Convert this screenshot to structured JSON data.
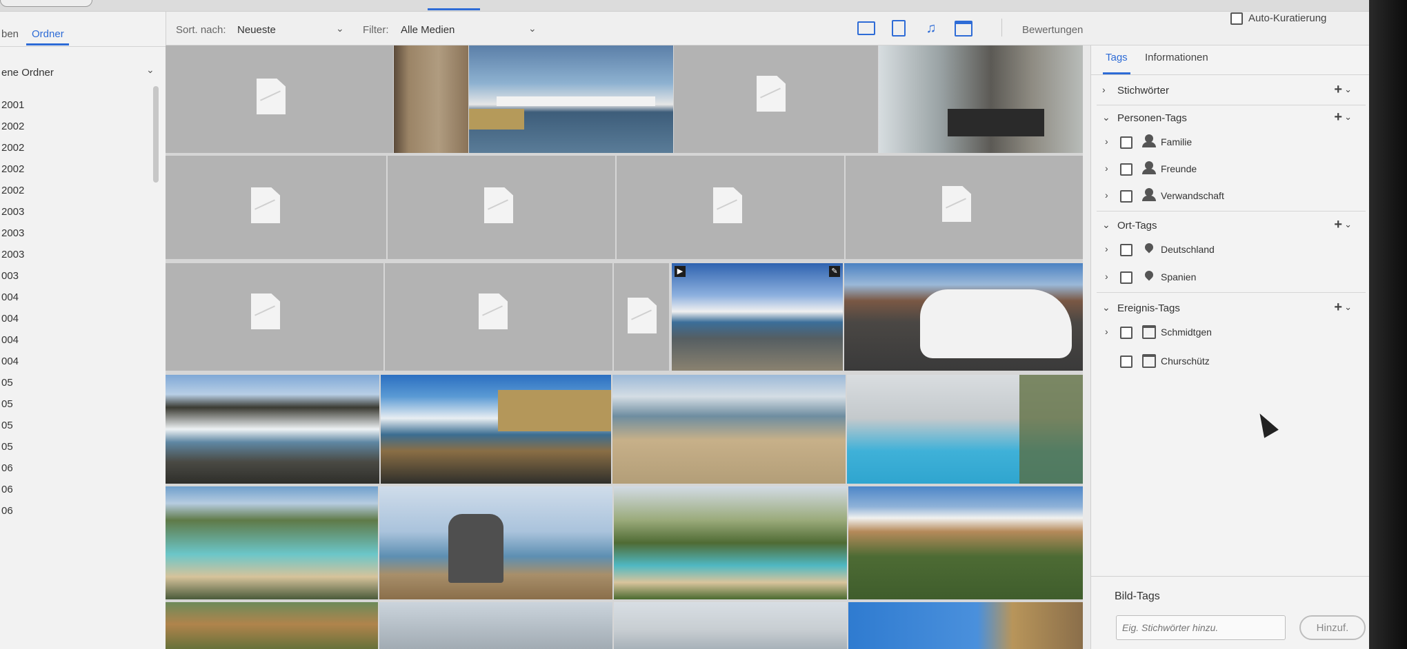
{
  "top": {
    "active_tab_indicator": true
  },
  "left_panel": {
    "tabs": [
      "ben",
      "Ordner"
    ],
    "active_tab": "Ordner",
    "tree_header": "ene Ordner",
    "years": [
      "2001",
      "2002",
      "2002",
      "2002",
      "2002",
      "2003",
      "2003",
      "2003",
      "003",
      "004",
      "004",
      "004",
      "004",
      "05",
      "05",
      "05",
      "05",
      "06",
      "06",
      "06"
    ]
  },
  "toolbar": {
    "sort_label": "Sort. nach:",
    "sort_value": "Neueste",
    "filter_label": "Filter:",
    "filter_value": "Alle Medien",
    "media_icons": [
      "photo-icon",
      "video-icon",
      "audio-icon",
      "project-icon"
    ],
    "rating_label": "Bewertungen",
    "rating_operator": "≥",
    "stars": "☆☆☆☆☆",
    "auto_curation_label": "Auto-Kuratierung"
  },
  "right_panel": {
    "tabs": [
      "Tags",
      "Informationen"
    ],
    "active_tab": "Tags",
    "sections": {
      "keywords": "Stichwörter",
      "people": {
        "title": "Personen-Tags",
        "items": [
          "Familie",
          "Freunde",
          "Verwandschaft"
        ]
      },
      "places": {
        "title": "Ort-Tags",
        "items": [
          "Deutschland",
          "Spanien"
        ]
      },
      "events": {
        "title": "Ereignis-Tags",
        "items": [
          "Schmidtgen",
          "Churschütz"
        ]
      }
    },
    "image_tags": {
      "title": "Bild-Tags",
      "input_placeholder": "Eig. Stichwörter hinzu.",
      "add_button": "Hinzuf."
    }
  },
  "colors": {
    "accent": "#2d6bd6",
    "placeholder_tile": "#b3b3b3"
  }
}
